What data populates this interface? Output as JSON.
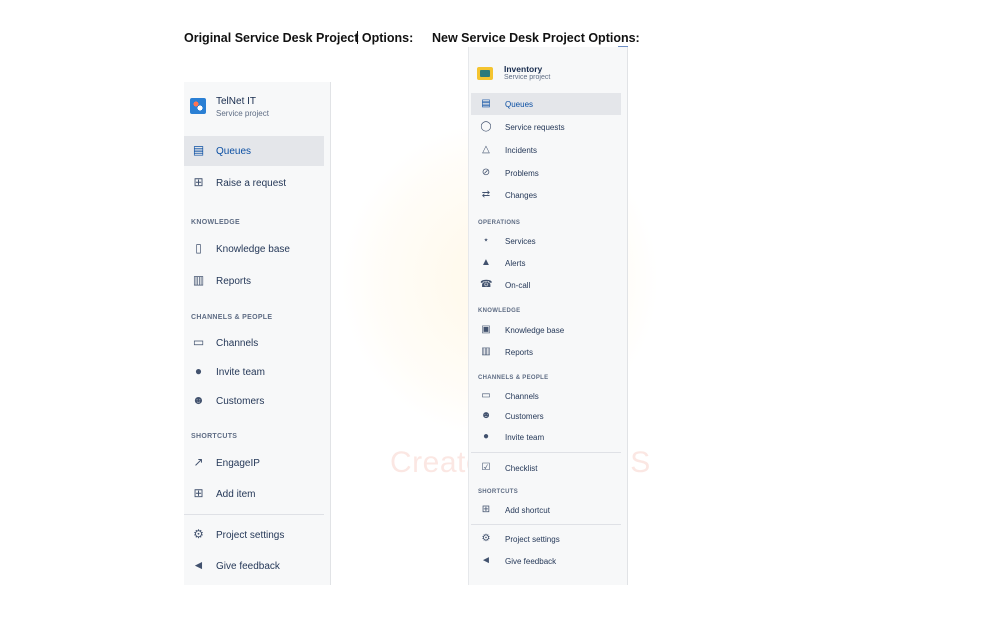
{
  "headings": {
    "original": "Original Service Desk Project Options:",
    "original_part1": "Original Service Desk Project",
    "original_part2": " Options:",
    "new": "New Service Desk Project Options:"
  },
  "watermark": {
    "text": "Created by Paint S"
  },
  "original_panel": {
    "project_name": "TelNet IT",
    "project_type": "Service project",
    "items": [
      {
        "label": "Queues",
        "icon": "queues-icon",
        "active": true
      },
      {
        "label": "Raise a request",
        "icon": "raise-request-icon"
      }
    ],
    "sections": {
      "knowledge": "KNOWLEDGE",
      "channels_people": "CHANNELS & PEOPLE",
      "shortcuts": "SHORTCUTS"
    },
    "knowledge_items": [
      {
        "label": "Knowledge base",
        "icon": "knowledge-base-icon"
      },
      {
        "label": "Reports",
        "icon": "reports-icon"
      }
    ],
    "channels_items": [
      {
        "label": "Channels",
        "icon": "channels-icon"
      },
      {
        "label": "Invite team",
        "icon": "invite-team-icon"
      },
      {
        "label": "Customers",
        "icon": "customers-icon"
      }
    ],
    "shortcut_items": [
      {
        "label": "EngageIP",
        "icon": "external-link-icon"
      },
      {
        "label": "Add item",
        "icon": "add-item-icon"
      }
    ],
    "footer_items": [
      {
        "label": "Project settings",
        "icon": "gear-icon"
      },
      {
        "label": "Give feedback",
        "icon": "megaphone-icon"
      }
    ]
  },
  "new_panel": {
    "project_name": "Inventory",
    "project_type": "Service project",
    "items": [
      {
        "label": "Queues",
        "icon": "queues-icon",
        "active": true
      },
      {
        "label": "Service requests",
        "icon": "speech-bubble-icon"
      },
      {
        "label": "Incidents",
        "icon": "triangle-icon"
      },
      {
        "label": "Problems",
        "icon": "no-entry-icon"
      },
      {
        "label": "Changes",
        "icon": "changes-icon"
      }
    ],
    "sections": {
      "operations": "OPERATIONS",
      "knowledge": "KNOWLEDGE",
      "channels_people": "CHANNELS & PEOPLE",
      "shortcuts": "SHORTCUTS"
    },
    "operations_items": [
      {
        "label": "Services",
        "icon": "services-icon"
      },
      {
        "label": "Alerts",
        "icon": "bell-icon"
      },
      {
        "label": "On-call",
        "icon": "on-call-icon"
      }
    ],
    "knowledge_items": [
      {
        "label": "Knowledge base",
        "icon": "knowledge-base-icon"
      },
      {
        "label": "Reports",
        "icon": "reports-icon"
      }
    ],
    "channels_items": [
      {
        "label": "Channels",
        "icon": "channels-icon"
      },
      {
        "label": "Customers",
        "icon": "customers-icon"
      },
      {
        "label": "Invite team",
        "icon": "invite-team-icon"
      }
    ],
    "checklist": {
      "label": "Checklist",
      "icon": "checklist-icon"
    },
    "shortcut_items": [
      {
        "label": "Add shortcut",
        "icon": "add-shortcut-icon"
      }
    ],
    "footer_items": [
      {
        "label": "Project settings",
        "icon": "gear-icon"
      },
      {
        "label": "Give feedback",
        "icon": "megaphone-icon"
      }
    ]
  }
}
